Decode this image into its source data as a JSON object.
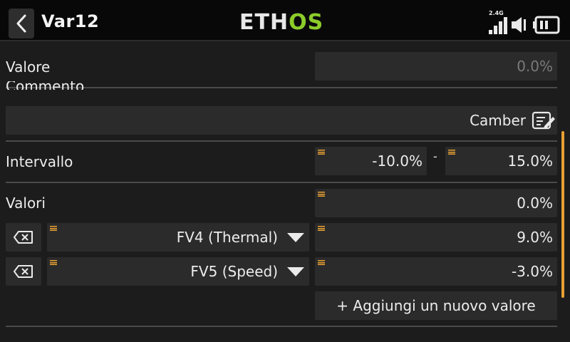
{
  "header": {
    "title": "Var12",
    "logo_part1": "ETH",
    "logo_part2": "OS",
    "radio_band": "2.4G"
  },
  "colors": {
    "accent": "#e8a032",
    "logo_green": "#8ccc2a",
    "background": "#1c1c1c",
    "field": "#2b2b2b"
  },
  "valore": {
    "label": "Valore",
    "value": "0.0%"
  },
  "commento": {
    "label": "Commento",
    "value": "Camber"
  },
  "intervallo": {
    "label": "Intervallo",
    "min": "-10.0%",
    "separator": "-",
    "max": "15.0%"
  },
  "valori": {
    "label": "Valori",
    "default_value": "0.0%",
    "items": [
      {
        "source": "FV4 (Thermal)",
        "value": "9.0%"
      },
      {
        "source": "FV5 (Speed)",
        "value": "-3.0%"
      }
    ],
    "add_label": "+ Aggiungi un nuovo valore"
  },
  "icons": [
    "back-chevron-icon",
    "signal-icon",
    "sound-icon",
    "battery-icon",
    "edit-icon",
    "delete-icon",
    "dropdown-caret-icon"
  ]
}
